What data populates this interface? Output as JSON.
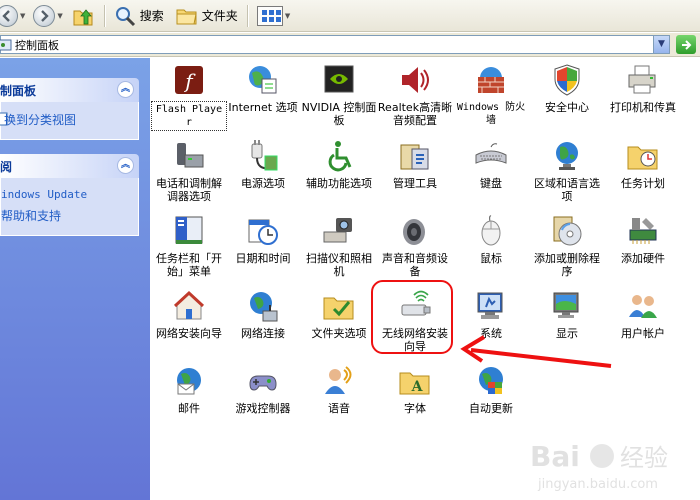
{
  "toolbar": {
    "back_label": "后退",
    "search_label": "搜索",
    "folders_label": "文件夹"
  },
  "address": {
    "text": "控制面板"
  },
  "taskpane": {
    "panel1_title": "制面板",
    "panel1_link": "换到分类视图",
    "panel2_title": "阅",
    "panel2_links": [
      "indows Update",
      "帮助和支持"
    ]
  },
  "items": [
    {
      "label": "Flash Player",
      "icon": "flash-player-icon"
    },
    {
      "label": "Internet 选项",
      "icon": "internet-options-icon"
    },
    {
      "label": "NVIDIA 控制面板",
      "icon": "nvidia-control-panel-icon"
    },
    {
      "label": "Realtek高清晰音频配置",
      "icon": "realtek-audio-icon"
    },
    {
      "label": "Windows 防火墙",
      "icon": "windows-firewall-icon"
    },
    {
      "label": "安全中心",
      "icon": "security-center-icon"
    },
    {
      "label": "打印机和传真",
      "icon": "printers-faxes-icon"
    },
    {
      "label": "电话和调制解调器选项",
      "icon": "phone-modem-icon"
    },
    {
      "label": "电源选项",
      "icon": "power-options-icon"
    },
    {
      "label": "辅助功能选项",
      "icon": "accessibility-icon"
    },
    {
      "label": "管理工具",
      "icon": "admin-tools-icon"
    },
    {
      "label": "键盘",
      "icon": "keyboard-icon"
    },
    {
      "label": "区域和语言选项",
      "icon": "region-language-icon"
    },
    {
      "label": "任务计划",
      "icon": "scheduled-tasks-icon"
    },
    {
      "label": "任务栏和「开始」菜单",
      "icon": "taskbar-start-menu-icon"
    },
    {
      "label": "日期和时间",
      "icon": "date-time-icon"
    },
    {
      "label": "扫描仪和照相机",
      "icon": "scanners-cameras-icon"
    },
    {
      "label": "声音和音频设备",
      "icon": "sounds-audio-icon"
    },
    {
      "label": "鼠标",
      "icon": "mouse-icon"
    },
    {
      "label": "添加或删除程序",
      "icon": "add-remove-programs-icon"
    },
    {
      "label": "添加硬件",
      "icon": "add-hardware-icon"
    },
    {
      "label": "网络安装向导",
      "icon": "network-setup-wizard-icon"
    },
    {
      "label": "网络连接",
      "icon": "network-connections-icon"
    },
    {
      "label": "文件夹选项",
      "icon": "folder-options-icon"
    },
    {
      "label": "无线网络安装向导",
      "icon": "wireless-network-wizard-icon"
    },
    {
      "label": "系统",
      "icon": "system-icon"
    },
    {
      "label": "显示",
      "icon": "display-icon"
    },
    {
      "label": "用户帐户",
      "icon": "user-accounts-icon"
    },
    {
      "label": "邮件",
      "icon": "mail-icon"
    },
    {
      "label": "游戏控制器",
      "icon": "game-controllers-icon"
    },
    {
      "label": "语音",
      "icon": "speech-icon"
    },
    {
      "label": "字体",
      "icon": "fonts-icon"
    },
    {
      "label": "自动更新",
      "icon": "automatic-updates-icon"
    }
  ],
  "watermark": {
    "brand": "Bai",
    "brand2": "经验",
    "url": "jingyan.baidu.com"
  },
  "colors": {
    "taskpane_top": "#7ba2e7",
    "taskpane_bottom": "#6375d6",
    "link": "#215dc6",
    "highlight": "#e11111"
  }
}
